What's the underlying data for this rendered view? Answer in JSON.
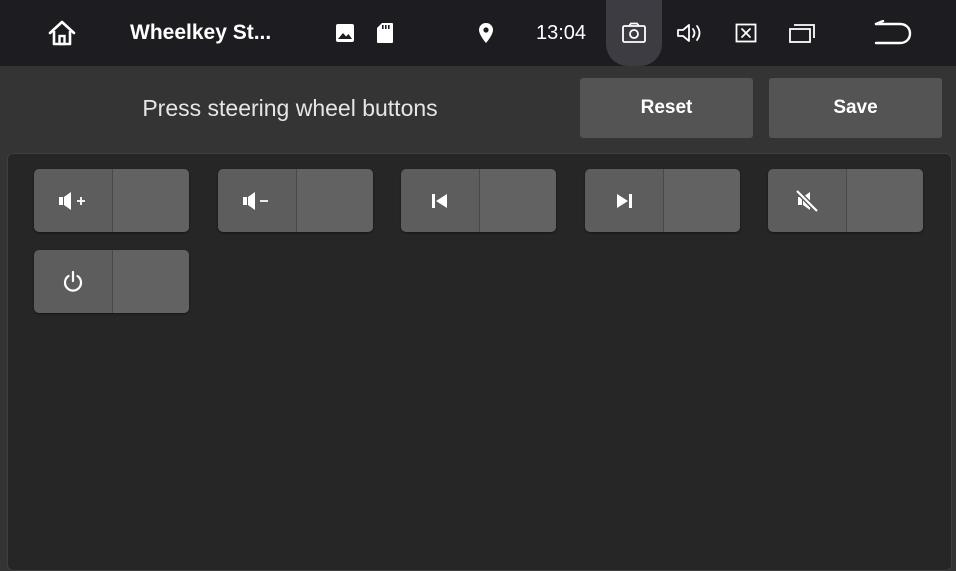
{
  "statusbar": {
    "title": "Wheelkey St...",
    "time": "13:04",
    "icons": [
      "home-icon",
      "image-icon",
      "sd-card-icon",
      "location-pin-icon",
      "screenshot-camera-icon",
      "volume-icon",
      "close-window-icon",
      "recent-apps-icon",
      "back-icon"
    ]
  },
  "header": {
    "prompt": "Press steering wheel buttons",
    "reset_label": "Reset",
    "save_label": "Save"
  },
  "keys": [
    {
      "icon": "volume-up-icon",
      "value": ""
    },
    {
      "icon": "volume-down-icon",
      "value": ""
    },
    {
      "icon": "previous-track-icon",
      "value": ""
    },
    {
      "icon": "next-track-icon",
      "value": ""
    },
    {
      "icon": "mute-icon",
      "value": ""
    },
    {
      "icon": "power-icon",
      "value": ""
    }
  ],
  "colors": {
    "statusbar_bg": "#1d1d21",
    "page_bg": "#343434",
    "panel_bg": "#262626",
    "button_bg": "#545454",
    "key_bg": "#5d5d5d"
  }
}
